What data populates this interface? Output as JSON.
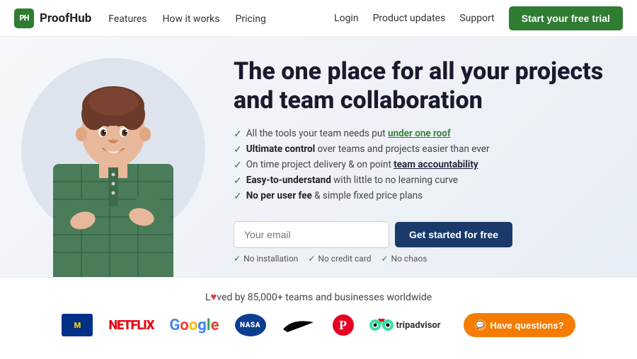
{
  "navbar": {
    "logo_icon": "PH",
    "logo_text": "ProofHub",
    "links": [
      {
        "label": "Features",
        "id": "features"
      },
      {
        "label": "How it works",
        "id": "how-it-works"
      },
      {
        "label": "Pricing",
        "id": "pricing"
      }
    ],
    "right_links": [
      {
        "label": "Login",
        "id": "login"
      },
      {
        "label": "Product updates",
        "id": "product-updates"
      },
      {
        "label": "Support",
        "id": "support"
      }
    ],
    "cta_label": "Start your free trial"
  },
  "hero": {
    "title": "The one place for all your projects and team collaboration",
    "features": [
      {
        "text_plain": "All the tools your team needs put ",
        "text_highlight": "under one roof",
        "text_after": "",
        "highlight_type": "green-underline"
      },
      {
        "text_plain": "",
        "text_highlight": "Ultimate control",
        "text_after": " over teams and projects easier than ever",
        "highlight_type": "bold"
      },
      {
        "text_plain": "On time project delivery & on point ",
        "text_highlight": "team accountability",
        "text_after": "",
        "highlight_type": "green-underline"
      },
      {
        "text_plain": "",
        "text_highlight": "Easy-to-understand",
        "text_after": " with little to no learning curve",
        "highlight_type": "bold"
      },
      {
        "text_plain": "",
        "text_highlight": "No per user fee",
        "text_after": " & simple fixed price plans",
        "highlight_type": "bold"
      }
    ],
    "email_placeholder": "Your email",
    "cta_button": "Get started for free",
    "trust_items": [
      "No installation",
      "No credit card",
      "No chaos"
    ]
  },
  "loved": {
    "text_before": "L",
    "heart": "♥",
    "text_after": "ved by 85,000+ teams and businesses worldwide"
  },
  "logos": [
    {
      "id": "michigan",
      "label": "M"
    },
    {
      "id": "netflix",
      "label": "NETFLIX"
    },
    {
      "id": "google",
      "label": "Google"
    },
    {
      "id": "nasa",
      "label": "NASA"
    },
    {
      "id": "nike",
      "label": "✓"
    },
    {
      "id": "pinterest",
      "label": "P"
    },
    {
      "id": "tripadvisor",
      "label": "tripadvisor"
    }
  ],
  "questions_button": "Have questions?"
}
